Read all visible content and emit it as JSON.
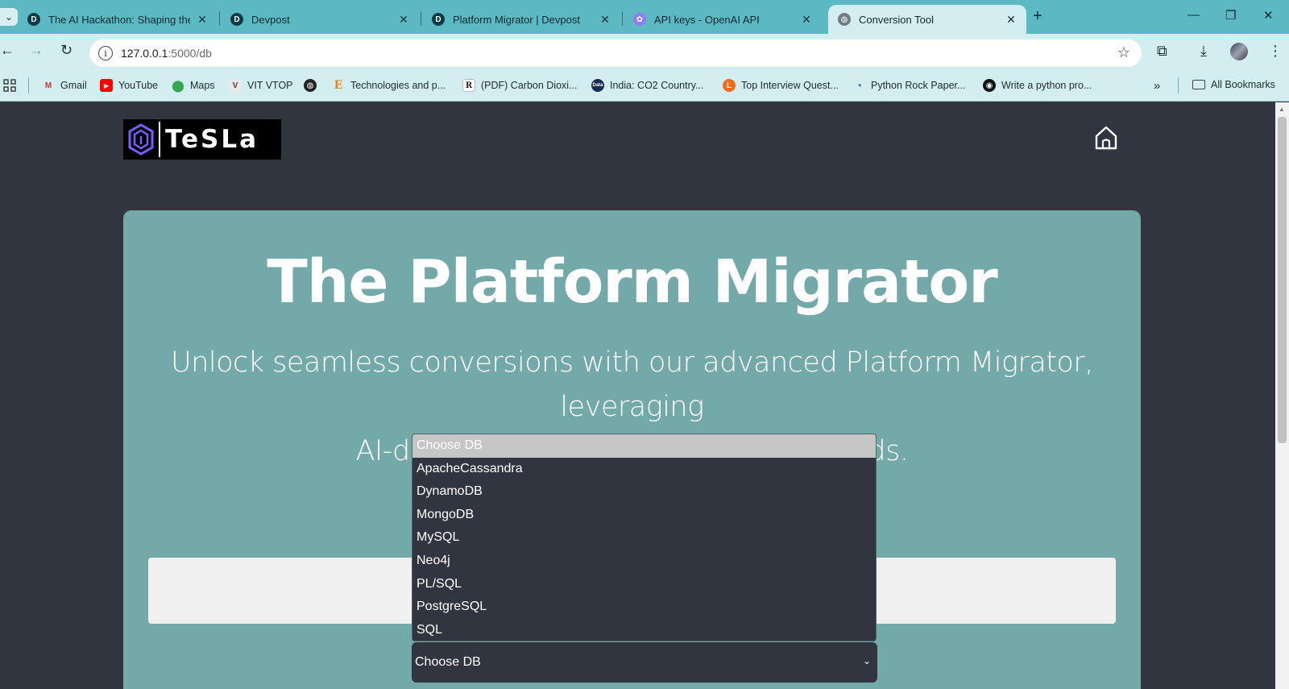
{
  "browser": {
    "tabs": [
      {
        "title": "The AI Hackathon: Shaping the",
        "favicon": "devpost-icon"
      },
      {
        "title": "Devpost",
        "favicon": "devpost-icon"
      },
      {
        "title": "Platform Migrator | Devpost",
        "favicon": "devpost-icon"
      },
      {
        "title": "API keys - OpenAI API",
        "favicon": "openai-icon"
      },
      {
        "title": "Conversion Tool",
        "favicon": "globe-icon",
        "active": true
      }
    ],
    "address": {
      "host": "127.0.0.1",
      "path": ":5000/db"
    },
    "bookmarks": [
      {
        "label": "Gmail",
        "icon": "gmail-icon"
      },
      {
        "label": "YouTube",
        "icon": "youtube-icon"
      },
      {
        "label": "Maps",
        "icon": "maps-icon"
      },
      {
        "label": "VIT VTOP",
        "icon": "vit-icon"
      },
      {
        "label": "",
        "icon": "globe-icon"
      },
      {
        "label": "Technologies and p...",
        "icon": "e-icon"
      },
      {
        "label": "(PDF) Carbon Dioxi...",
        "icon": "researchgate-icon"
      },
      {
        "label": "India: CO2 Country...",
        "icon": "data-icon"
      },
      {
        "label": "Top Interview Quest...",
        "icon": "leetcode-icon"
      },
      {
        "label": "Python Rock Paper...",
        "icon": "python-icon"
      },
      {
        "label": "Write a python pro...",
        "icon": "github-icon"
      }
    ],
    "all_bookmarks": "All Bookmarks"
  },
  "page": {
    "logo_text": "TeSLa",
    "hero_title": "The Platform Migrator",
    "hero_subtitle_line1": "Unlock seamless conversions with our advanced Platform Migrator, leveraging",
    "hero_subtitle_line2": "AI-driven transformation for your needs.",
    "db_select": {
      "selected": "Choose DB",
      "options": [
        "Choose DB",
        "ApacheCassandra",
        "DynamoDB",
        "MongoDB",
        "MySQL",
        "Neo4j",
        "PL/SQL",
        "PostgreSQL",
        "SQL"
      ]
    }
  },
  "colors": {
    "tabstrip": "#5cb9c3",
    "toolbar": "#d3eef1",
    "page_bg": "#31353f",
    "card_bg": "#74a9aa",
    "option_highlight": "#c6c6c6"
  }
}
